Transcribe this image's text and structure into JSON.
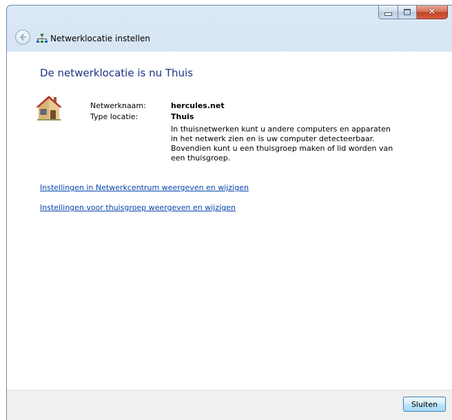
{
  "window": {
    "title": "Netwerklocatie instellen",
    "caption_buttons": [
      "minimize",
      "maximize",
      "close"
    ]
  },
  "icons": {
    "back": "back-arrow-icon",
    "network": "network-icon",
    "house": "house-icon"
  },
  "main": {
    "heading": "De netwerklocatie is nu Thuis",
    "network_name_label": "Netwerknaam:",
    "network_name_value": "hercules.net",
    "location_type_label": "Type locatie:",
    "location_type_value": "Thuis",
    "description": "In thuisnetwerken kunt u andere computers en apparaten in het netwerk zien en is uw computer detecteerbaar. Bovendien kunt u een thuisgroep maken of lid worden van een thuisgroep."
  },
  "links": [
    "Instellingen in Netwerkcentrum weergeven en wijzigen",
    "Instellingen voor thuisgroep weergeven en wijzigen"
  ],
  "footer": {
    "close_label": "Sluiten"
  },
  "colors": {
    "heading": "#1e3287",
    "link": "#0645ad",
    "frame": "#c9dced"
  }
}
